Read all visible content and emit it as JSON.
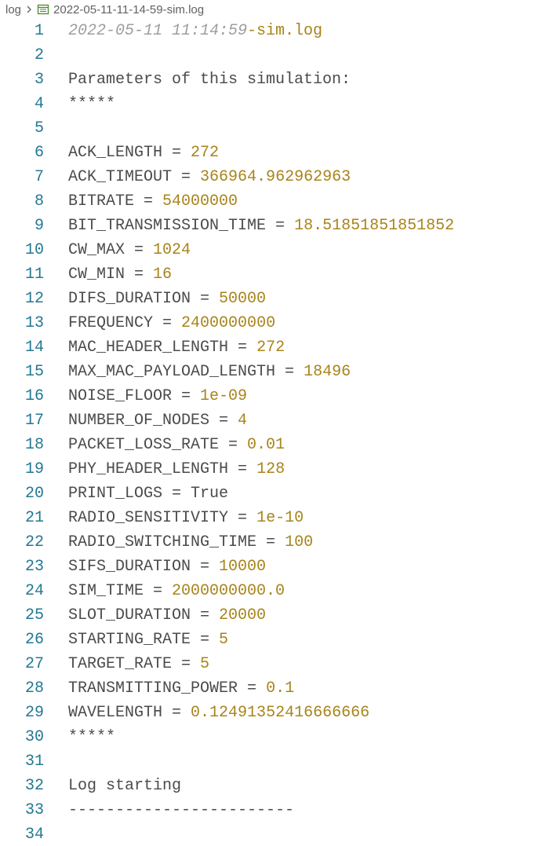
{
  "breadcrumb": {
    "folder": "log",
    "file": "2022-05-11-11-14-59-sim.log"
  },
  "editor": {
    "title_line": {
      "timestamp": "2022-05-11 11:14:59",
      "suffix": "-sim.log"
    },
    "heading": "Parameters of this simulation:",
    "stars_open": "*****",
    "params": [
      {
        "key": "ACK_LENGTH",
        "value": "272"
      },
      {
        "key": "ACK_TIMEOUT",
        "value": "366964.962962963"
      },
      {
        "key": "BITRATE",
        "value": "54000000"
      },
      {
        "key": "BIT_TRANSMISSION_TIME",
        "value": "18.51851851851852"
      },
      {
        "key": "CW_MAX",
        "value": "1024"
      },
      {
        "key": "CW_MIN",
        "value": "16"
      },
      {
        "key": "DIFS_DURATION",
        "value": "50000"
      },
      {
        "key": "FREQUENCY",
        "value": "2400000000"
      },
      {
        "key": "MAC_HEADER_LENGTH",
        "value": "272"
      },
      {
        "key": "MAX_MAC_PAYLOAD_LENGTH",
        "value": "18496"
      },
      {
        "key": "NOISE_FLOOR",
        "value": "1e-09"
      },
      {
        "key": "NUMBER_OF_NODES",
        "value": "4"
      },
      {
        "key": "PACKET_LOSS_RATE",
        "value": "0.01"
      },
      {
        "key": "PHY_HEADER_LENGTH",
        "value": "128"
      },
      {
        "key": "PRINT_LOGS",
        "value": "True"
      },
      {
        "key": "RADIO_SENSITIVITY",
        "value": "1e-10"
      },
      {
        "key": "RADIO_SWITCHING_TIME",
        "value": "100"
      },
      {
        "key": "SIFS_DURATION",
        "value": "10000"
      },
      {
        "key": "SIM_TIME",
        "value": "2000000000.0"
      },
      {
        "key": "SLOT_DURATION",
        "value": "20000"
      },
      {
        "key": "STARTING_RATE",
        "value": "5"
      },
      {
        "key": "TARGET_RATE",
        "value": "5"
      },
      {
        "key": "TRANSMITTING_POWER",
        "value": "0.1"
      },
      {
        "key": "WAVELENGTH",
        "value": "0.12491352416666666"
      }
    ],
    "stars_close": "*****",
    "log_start": "Log starting",
    "dashes": "------------------------",
    "line_numbers": [
      "1",
      "2",
      "3",
      "4",
      "5",
      "6",
      "7",
      "8",
      "9",
      "10",
      "11",
      "12",
      "13",
      "14",
      "15",
      "16",
      "17",
      "18",
      "19",
      "20",
      "21",
      "22",
      "23",
      "24",
      "25",
      "26",
      "27",
      "28",
      "29",
      "30",
      "31",
      "32",
      "33",
      "34"
    ]
  },
  "colors": {
    "line_number": "#237893",
    "number_value": "#a8841a",
    "plain_text": "#4b4b4b",
    "timestamp": "#9e9e9e"
  }
}
